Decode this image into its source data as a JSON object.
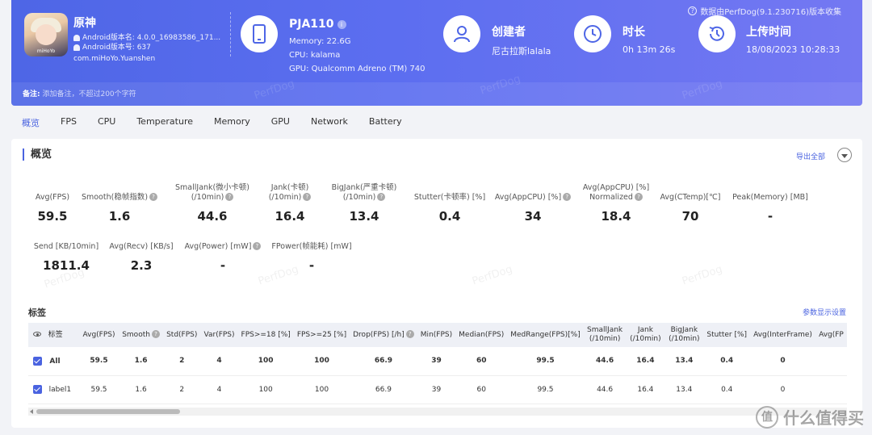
{
  "header": {
    "collect_note": "数据由PerfDog(9.1.230716)版本收集",
    "app": {
      "name": "原神",
      "android_version_name": "Android版本名: 4.0.0_16983586_171...",
      "android_version_code": "Android版本号: 637",
      "package": "com.miHoYo.Yuanshen",
      "icon_text": "miHoYo"
    },
    "device": {
      "name": "PJA110",
      "memory": "Memory: 22.6G",
      "cpu": "CPU: kalama",
      "gpu": "GPU: Qualcomm Adreno (TM) 740"
    },
    "creator": {
      "title": "创建者",
      "value": "尼古拉斯lalala"
    },
    "duration": {
      "title": "时长",
      "value": "0h 13m 26s"
    },
    "upload": {
      "title": "上传时间",
      "value": "18/08/2023 10:28:33"
    },
    "note_label": "备注:",
    "note_placeholder": "添加备注，不超过200个字符",
    "watermark": "PerfDog"
  },
  "tabs": [
    "概览",
    "FPS",
    "CPU",
    "Temperature",
    "Memory",
    "GPU",
    "Network",
    "Battery"
  ],
  "overview": {
    "title": "概览",
    "export_label": "导出全部",
    "metrics": [
      {
        "label": "Avg(FPS)",
        "value": "59.5"
      },
      {
        "label": "Smooth(稳帧指数)",
        "value": "1.6"
      },
      {
        "label": "SmallJank(微小卡顿)",
        "label2": "(/10min)",
        "value": "44.6"
      },
      {
        "label": "Jank(卡顿)",
        "label2": "(/10min)",
        "value": "16.4"
      },
      {
        "label": "BigJank(严重卡顿)",
        "label2": "(/10min)",
        "value": "13.4"
      },
      {
        "label": "Stutter(卡顿率) [%]",
        "value": "0.4"
      },
      {
        "label": "Avg(AppCPU) [%]",
        "value": "34"
      },
      {
        "label": "Avg(AppCPU) [%]",
        "label2": "Normalized",
        "value": "18.4"
      },
      {
        "label": "Avg(CTemp)[℃]",
        "value": "70"
      },
      {
        "label": "Peak(Memory) [MB]",
        "value": "-"
      },
      {
        "label": "Send [KB/10min]",
        "value": "1811.4"
      },
      {
        "label": "Avg(Recv) [KB/s]",
        "value": "2.3"
      },
      {
        "label": "Avg(Power) [mW]",
        "value": "-"
      },
      {
        "label": "FPower(帧能耗) [mW]",
        "value": "-"
      }
    ]
  },
  "tags": {
    "title": "标签",
    "param_link": "参数显示设置",
    "columns": [
      "标签",
      "Avg(FPS)",
      "Smooth",
      "Std(FPS)",
      "Var(FPS)",
      "FPS>=18 [%]",
      "FPS>=25 [%]",
      "Drop(FPS) [/h]",
      "Min(FPS)",
      "Median(FPS)",
      "MedRange(FPS)[%]",
      "SmallJank (/10min)",
      "Jank (/10min)",
      "BigJank (/10min)",
      "Stutter [%]",
      "Avg(InterFrame)",
      "Avg(FP"
    ],
    "rows": [
      {
        "name": "All",
        "values": [
          "59.5",
          "1.6",
          "2",
          "4",
          "100",
          "100",
          "66.9",
          "39",
          "60",
          "99.5",
          "44.6",
          "16.4",
          "13.4",
          "0.4",
          "0",
          ""
        ]
      },
      {
        "name": "label1",
        "values": [
          "59.5",
          "1.6",
          "2",
          "4",
          "100",
          "100",
          "66.9",
          "39",
          "60",
          "99.5",
          "44.6",
          "16.4",
          "13.4",
          "0.4",
          "0",
          ""
        ]
      }
    ]
  },
  "brand": {
    "text": "什么值得买",
    "logo": "值"
  }
}
